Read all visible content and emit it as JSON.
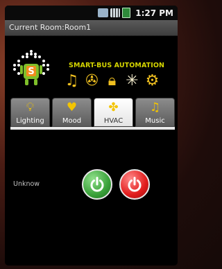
{
  "status_bar": {
    "time": "1:27 PM",
    "icons": [
      "network-icon",
      "signal-icon",
      "battery-icon"
    ]
  },
  "title_bar": {
    "title": "Current Room:Room1"
  },
  "header": {
    "brand_text": "SMART-BUS AUTOMATION",
    "logo_letter": "S",
    "feature_icons": [
      "music-note-icon",
      "hvac-fan-icon",
      "lock-icon",
      "light-burst-icon",
      "projector-icon"
    ]
  },
  "tabs": [
    {
      "label": "Lighting",
      "icon": "bulb-icon",
      "active": false
    },
    {
      "label": "Mood",
      "icon": "heart-icon",
      "active": false
    },
    {
      "label": "HVAC",
      "icon": "fan-icon",
      "active": true
    },
    {
      "label": "Music",
      "icon": "music-note-icon",
      "active": false
    }
  ],
  "content": {
    "device_label": "Unknow",
    "buttons": [
      {
        "name": "power-on",
        "color": "#3aa13a"
      },
      {
        "name": "power-off",
        "color": "#e21c1c"
      }
    ]
  },
  "colors": {
    "accent": "#f3c400",
    "brand": "#d4d400"
  }
}
